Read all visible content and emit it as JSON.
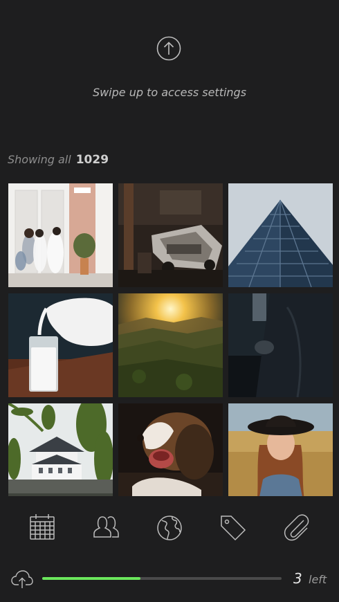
{
  "header": {
    "swipe_text": "Swipe up to access settings"
  },
  "gallery": {
    "showing_label": "Showing all",
    "total_count": "1029",
    "photos": [
      {
        "name": "photo-people-walking"
      },
      {
        "name": "photo-abandoned-car"
      },
      {
        "name": "photo-blue-building"
      },
      {
        "name": "photo-milk-pour"
      },
      {
        "name": "photo-sunset-hills"
      },
      {
        "name": "photo-dark-jacket"
      },
      {
        "name": "photo-japanese-castle"
      },
      {
        "name": "photo-yawning-puppy"
      },
      {
        "name": "photo-woman-hat"
      }
    ]
  },
  "toolbar": {
    "items": [
      "calendar-icon",
      "people-icon",
      "globe-icon",
      "tag-icon",
      "paperclip-icon"
    ]
  },
  "upload": {
    "progress": 0.41,
    "remaining_count": "3",
    "remaining_label": "left",
    "progress_color": "#6be75c"
  }
}
